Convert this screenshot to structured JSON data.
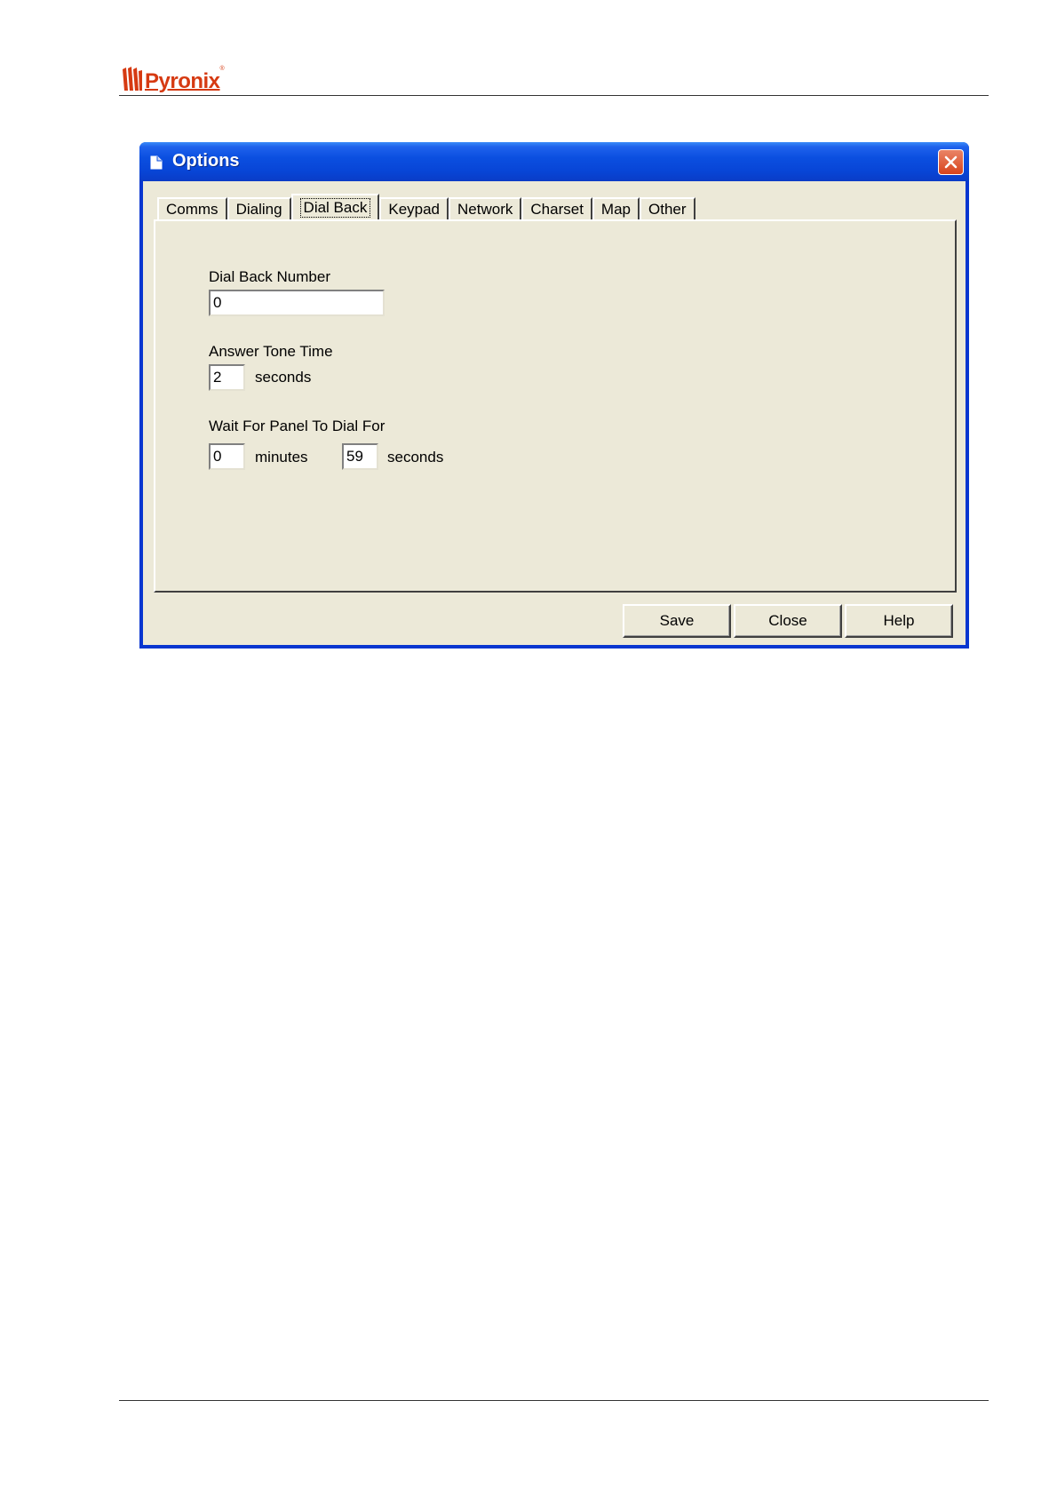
{
  "brand": {
    "name": "Pyronix",
    "reg": "®"
  },
  "window": {
    "title": "Options"
  },
  "tabs": [
    {
      "label": "Comms",
      "active": false
    },
    {
      "label": "Dialing",
      "active": false
    },
    {
      "label": "Dial Back",
      "active": true
    },
    {
      "label": "Keypad",
      "active": false
    },
    {
      "label": "Network",
      "active": false
    },
    {
      "label": "Charset",
      "active": false
    },
    {
      "label": "Map",
      "active": false
    },
    {
      "label": "Other",
      "active": false
    }
  ],
  "dial_back": {
    "number_label": "Dial Back Number",
    "number_value": "0",
    "answer_tone_label": "Answer Tone Time",
    "answer_tone_value": "2",
    "answer_tone_unit": "seconds",
    "wait_label": "Wait For Panel To Dial For",
    "wait_minutes_value": "0",
    "wait_minutes_unit": "minutes",
    "wait_seconds_value": "59",
    "wait_seconds_unit": "seconds"
  },
  "buttons": {
    "save": "Save",
    "close": "Close",
    "help": "Help"
  },
  "colors": {
    "title_bar": "#0b4fe0",
    "dialog_face": "#ece9d8",
    "brand": "#d63a12",
    "close_button": "#d8431c"
  }
}
